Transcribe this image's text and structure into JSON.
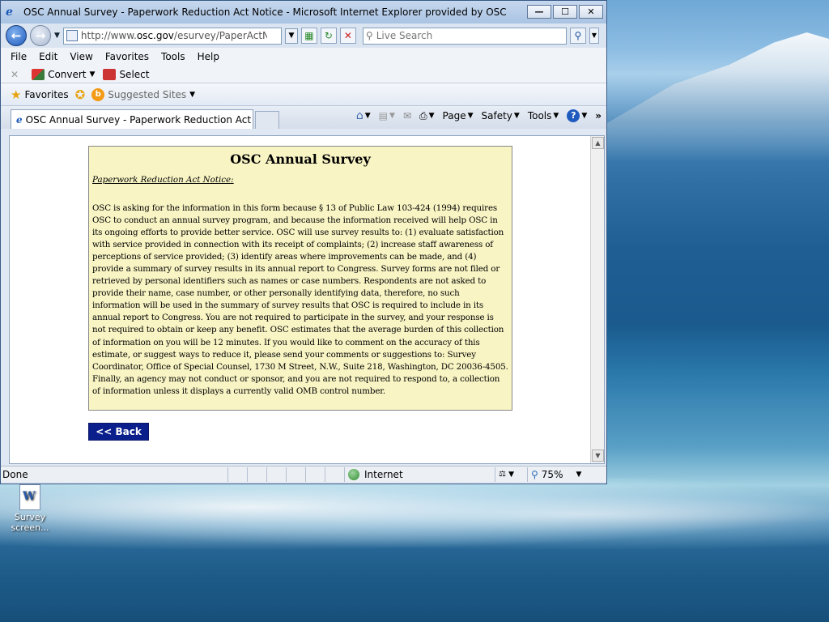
{
  "window": {
    "title": "OSC Annual Survey - Paperwork Reduction Act Notice - Microsoft Internet Explorer provided by OSC",
    "minimize": "—",
    "maximize": "☐",
    "close": "✕"
  },
  "address": {
    "url_prefix": "http://www.",
    "url_domain": "osc.gov",
    "url_path": "/esurvey/PaperActNoti",
    "search_placeholder": "Live Search"
  },
  "menu": [
    "File",
    "Edit",
    "View",
    "Favorites",
    "Tools",
    "Help"
  ],
  "command_bar": {
    "convert": "Convert",
    "select": "Select"
  },
  "favorites_bar": {
    "favorites": "Favorites",
    "suggested": "Suggested Sites"
  },
  "tab": {
    "label": "OSC Annual Survey - Paperwork Reduction Act N..."
  },
  "tab_tools": {
    "page": "Page",
    "safety": "Safety",
    "tools": "Tools"
  },
  "page": {
    "heading": "OSC Annual Survey",
    "subheading": "Paperwork Reduction Act Notice:",
    "body": "OSC is asking for the information in this form because § 13 of Public Law 103-424 (1994) requires OSC to conduct an annual survey program, and because the information received will help OSC in its ongoing efforts to provide better service. OSC will use survey results to: (1) evaluate satisfaction with service provided in connection with its receipt of complaints; (2) increase staff awareness of perceptions of service provided; (3) identify areas where improvements can be made, and (4) provide a summary of survey results in its annual report to Congress. Survey forms are not filed or retrieved by personal identifiers such as names or case numbers. Respondents are not asked to provide their name, case number, or other personally identifying data, therefore, no such information will be used in the summary of survey results that OSC is required to include in its annual report to Congress. You are not required to participate in the survey, and your response is not required to obtain or keep any benefit. OSC estimates that the average burden of this collection of information on you will be 12 minutes. If you would like to comment on the accuracy of this estimate, or suggest ways to reduce it, please send your comments or suggestions to: Survey Coordinator, Office of Special Counsel, 1730 M Street, N.W., Suite 218, Washington, DC 20036-4505. Finally, an agency may not conduct or sponsor, and you are not required to respond to, a collection of information unless it displays a currently valid OMB control number.",
    "back_button": "<< Back"
  },
  "status": {
    "done": "Done",
    "zone": "Internet",
    "zoom": "75%"
  },
  "desktop": {
    "icon_label": "Survey screen..."
  },
  "colors": {
    "notice_bg": "#f8f4c4",
    "back_button_bg": "#0b1f8c"
  }
}
